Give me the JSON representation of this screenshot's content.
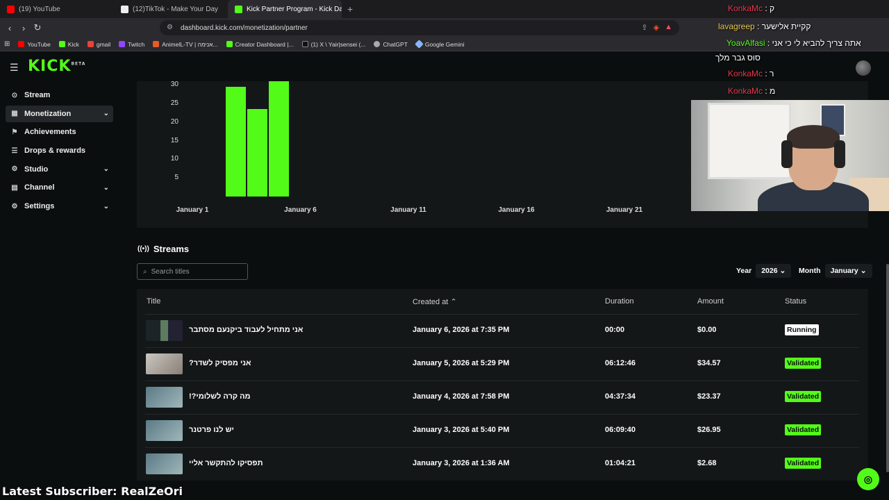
{
  "browser": {
    "tabs": [
      {
        "label": "(19) YouTube",
        "color": "#ff0000"
      },
      {
        "label": "(12)TikTok - Make Your Day",
        "color": "#ffffff"
      },
      {
        "label": "Kick Partner Program - Kick Dash",
        "color": "#53fc18",
        "active": true
      }
    ],
    "new_tab": "+",
    "url": "dashboard.kick.com/monetization/partner",
    "bookmarks": [
      {
        "label": "YouTube",
        "color": "#ff0000"
      },
      {
        "label": "Kick",
        "color": "#53fc18"
      },
      {
        "label": "gmail",
        "color": "#ea4335"
      },
      {
        "label": "Twitch",
        "color": "#9146ff"
      },
      {
        "label": "AnimelL-TV | אנימה...",
        "color": "#e85a2a"
      },
      {
        "label": "Creator Dashboard |...",
        "color": "#53fc18"
      },
      {
        "label": "(1) X \\ Yair|sensei (...",
        "color": "#111111"
      },
      {
        "label": "ChatGPT",
        "color": "#aaaaaa"
      },
      {
        "label": "Google Gemini",
        "color": "#8ab4f8"
      }
    ]
  },
  "app": {
    "logo": "KICK",
    "logo_sup": "BETA",
    "sidebar": [
      {
        "label": "Stream",
        "icon": "⊙",
        "chevron": false,
        "active": false
      },
      {
        "label": "Monetization",
        "icon": "▦",
        "chevron": true,
        "active": true
      },
      {
        "label": "Achievements",
        "icon": "⚑",
        "chevron": false,
        "active": false
      },
      {
        "label": "Drops & rewards",
        "icon": "☰",
        "chevron": false,
        "active": false
      },
      {
        "label": "Studio",
        "icon": "⚙",
        "chevron": true,
        "active": false
      },
      {
        "label": "Channel",
        "icon": "▤",
        "chevron": true,
        "active": false
      },
      {
        "label": "Settings",
        "icon": "⚙",
        "chevron": true,
        "active": false
      }
    ]
  },
  "chart_data": {
    "type": "bar",
    "y_ticks": [
      "30",
      "25",
      "20",
      "15",
      "10",
      "5"
    ],
    "x_ticks": [
      "January 1",
      "January 6",
      "January 11",
      "January 16",
      "January 21"
    ],
    "categories": [
      "January 3",
      "January 4",
      "January 5"
    ],
    "values": [
      29.5,
      23.5,
      31
    ],
    "ylim": [
      0,
      31
    ],
    "color": "#53fc18"
  },
  "streams": {
    "heading": "Streams",
    "search_placeholder": "Search titles",
    "year_label": "Year",
    "year_value": "2026",
    "month_label": "Month",
    "month_value": "January",
    "columns": {
      "title": "Title",
      "created": "Created at",
      "duration": "Duration",
      "amount": "Amount",
      "status": "Status"
    },
    "rows": [
      {
        "title": "אני מתחיל לעבוד ביקנעם מסתבר",
        "created": "January 6, 2026 at 7:35 PM",
        "duration": "00:00",
        "amount": "$0.00",
        "status": "Running"
      },
      {
        "title": "אני מפסיק לשדר?",
        "created": "January 5, 2026 at 5:29 PM",
        "duration": "06:12:46",
        "amount": "$34.57",
        "status": "Validated"
      },
      {
        "title": "מה קרה לשלומי?!",
        "created": "January 4, 2026 at 7:58 PM",
        "duration": "04:37:34",
        "amount": "$23.37",
        "status": "Validated"
      },
      {
        "title": "יש לנו פרטנר",
        "created": "January 3, 2026 at 5:40 PM",
        "duration": "06:09:40",
        "amount": "$26.95",
        "status": "Validated"
      },
      {
        "title": "תפסיקו להתקשר אליי",
        "created": "January 3, 2026 at 1:36 AM",
        "duration": "01:04:21",
        "amount": "$2.68",
        "status": "Validated"
      }
    ]
  },
  "overlay": {
    "chat": [
      {
        "name": "KonkaMc",
        "sep": " : ",
        "msg": "ק",
        "name_color": "red"
      },
      {
        "name": "lavagreep",
        "sep": " : ",
        "msg": "קקיית אלישער",
        "name_color": "gold"
      },
      {
        "name": "YoavAlfasi",
        "sep": " : ",
        "msg": "אתה צריך להביא לי כי אני",
        "name_color": "green"
      },
      {
        "name": "",
        "sep": "",
        "msg": "סוס גבר מלך",
        "name_color": "none"
      },
      {
        "name": "KonkaMc",
        "sep": " : ",
        "msg": "ר",
        "name_color": "red"
      },
      {
        "name": "KonkaMc",
        "sep": " : ",
        "msg": "מ",
        "name_color": "red"
      }
    ],
    "latest_subscriber": "Latest Subscriber: RealZeOri"
  }
}
